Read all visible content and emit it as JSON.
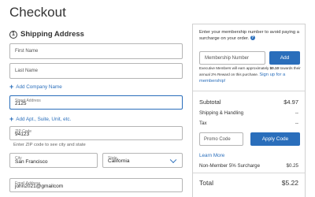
{
  "page": {
    "title": "Checkout"
  },
  "shipping": {
    "step": "1",
    "heading": "Shipping Address",
    "first_name": {
      "placeholder": "First Name",
      "value": ""
    },
    "last_name": {
      "placeholder": "Last Name",
      "value": ""
    },
    "add_company": "Add Company Name",
    "street": {
      "label": "Street Address",
      "value": "2125"
    },
    "add_apt": "Add Apt., Suite, Unit, etc.",
    "zip": {
      "label": "ZIP Code",
      "value": "94123",
      "hint": "Enter ZIP code to see city and state"
    },
    "city": {
      "label": "City",
      "value": "San Francisco"
    },
    "state": {
      "label": "State",
      "value": "California"
    },
    "email": {
      "label": "Email Address",
      "value": "john2021@gmailcom"
    }
  },
  "summary": {
    "membership_prompt": "Enter your membership number to avoid paying a surcharge on your order.",
    "membership_placeholder": "Membership Number",
    "add_button": "Add",
    "exec_note_pre": "Executive Members will earn approximately ",
    "exec_amount": "$0.10",
    "exec_note_post": " towards their annual 2% Reward on this purchase.",
    "signup_link": "Sign up for a membership!",
    "subtotal_label": "Subtotal",
    "subtotal_value": "$4.97",
    "shipping_label": "Shipping & Handling",
    "shipping_value": "--",
    "tax_label": "Tax",
    "tax_value": "--",
    "promo_placeholder": "Promo Code",
    "apply_button": "Apply Code",
    "learn_more": "Learn More",
    "surcharge_label": "Non-Member 5% Surcharge",
    "surcharge_value": "$0.25",
    "total_label": "Total",
    "total_value": "$5.22"
  },
  "colors": {
    "accent": "#2a6ebb",
    "text": "#333333",
    "border": "#b5b5b5"
  },
  "icons": {
    "info": "info-icon",
    "state_dropdown": "chevron-down-icon",
    "add": "plus-icon"
  }
}
